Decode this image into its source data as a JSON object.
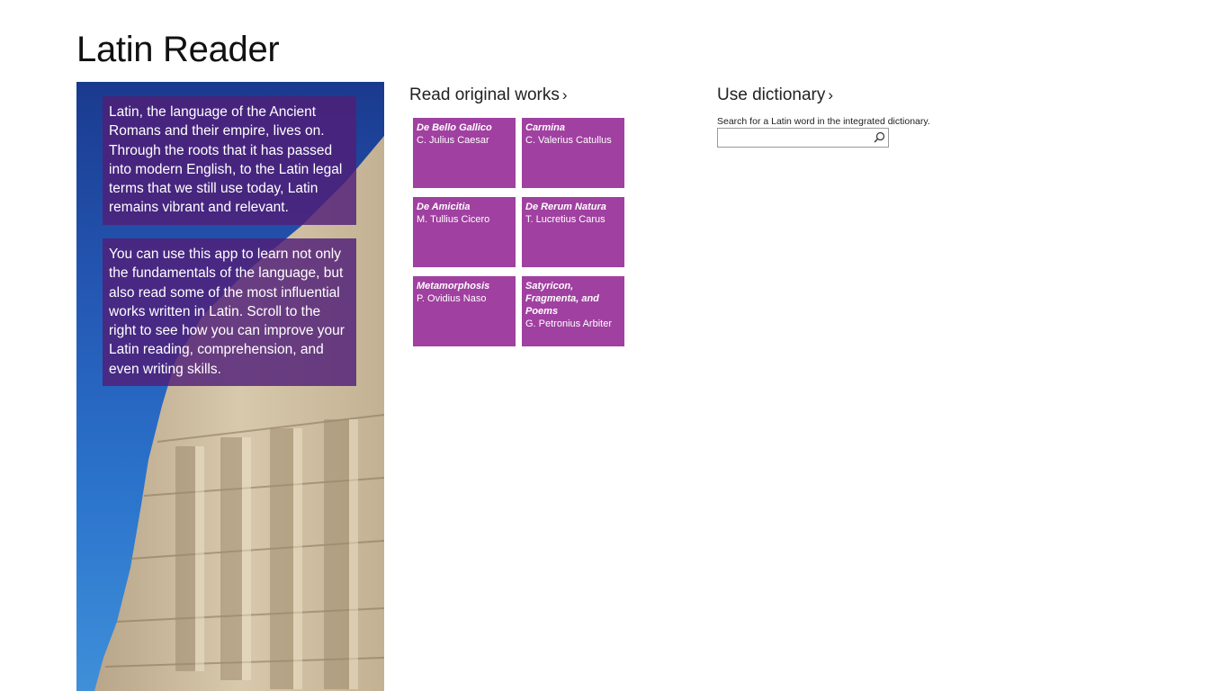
{
  "app": {
    "title": "Latin Reader"
  },
  "hero": {
    "paragraph1": "Latin, the language of the Ancient Romans and their empire, lives on. Through the roots that it has passed into modern English, to the Latin legal terms that we still use today, Latin remains vibrant and relevant.",
    "paragraph2": "You can use this app to learn not only the fundamentals of the language, but also read some of the most influential works written in Latin. Scroll to the right to see how you can improve your Latin reading, comprehension, and even writing skills."
  },
  "works": {
    "header": "Read original works",
    "chevron": "›",
    "tiles": [
      {
        "title": "De Bello Gallico",
        "author": "C. Julius Caesar"
      },
      {
        "title": "Carmina",
        "author": "C. Valerius Catullus"
      },
      {
        "title": "De Amicitia",
        "author": "M. Tullius Cicero"
      },
      {
        "title": "De Rerum Natura",
        "author": "T. Lucretius Carus"
      },
      {
        "title": "Metamorphosis",
        "author": "P. Ovidius Naso"
      },
      {
        "title": "Satyricon, Fragmenta, and Poems",
        "author": "G. Petronius Arbiter"
      }
    ]
  },
  "dictionary": {
    "header": "Use dictionary",
    "chevron": "›",
    "description": "Search for a Latin word in the integrated dictionary.",
    "search_value": "",
    "search_icon": "search-icon"
  },
  "colors": {
    "tile": "#a040a0",
    "hero_overlay": "#501e78",
    "sky": "#2458b4"
  }
}
